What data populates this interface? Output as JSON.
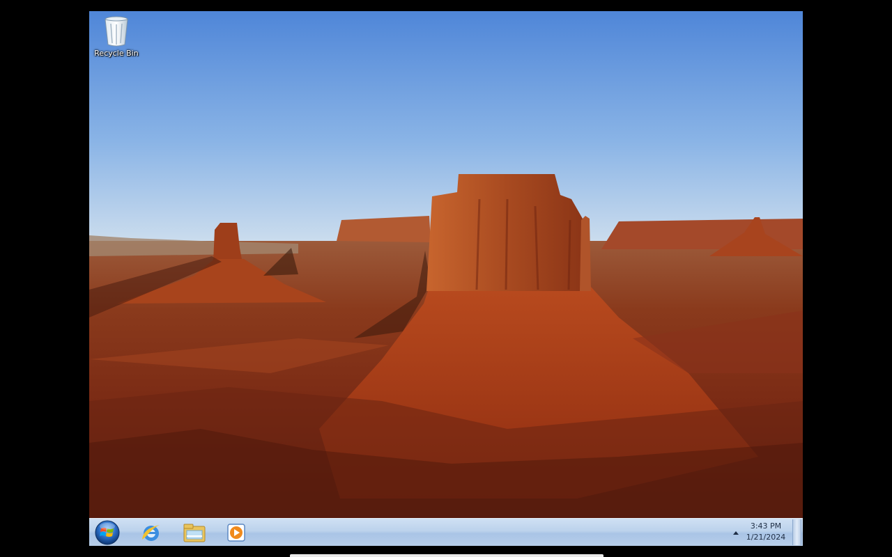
{
  "desktop": {
    "icons": [
      {
        "label": "Recycle Bin",
        "icon": "recycle-bin-icon"
      }
    ]
  },
  "taskbar": {
    "start_icon": "windows-start-orb-icon",
    "pinned": [
      {
        "icon": "internet-explorer-icon"
      },
      {
        "icon": "windows-explorer-icon"
      },
      {
        "icon": "windows-media-player-icon"
      }
    ],
    "tray": {
      "notification_icon": "show-hidden-icons-arrow-icon",
      "time": "3:43 PM",
      "date": "1/21/2024"
    }
  },
  "colors": {
    "taskbar": "#bcd2ec",
    "sky": "#5d8fd6",
    "rock": "#b8431c"
  }
}
